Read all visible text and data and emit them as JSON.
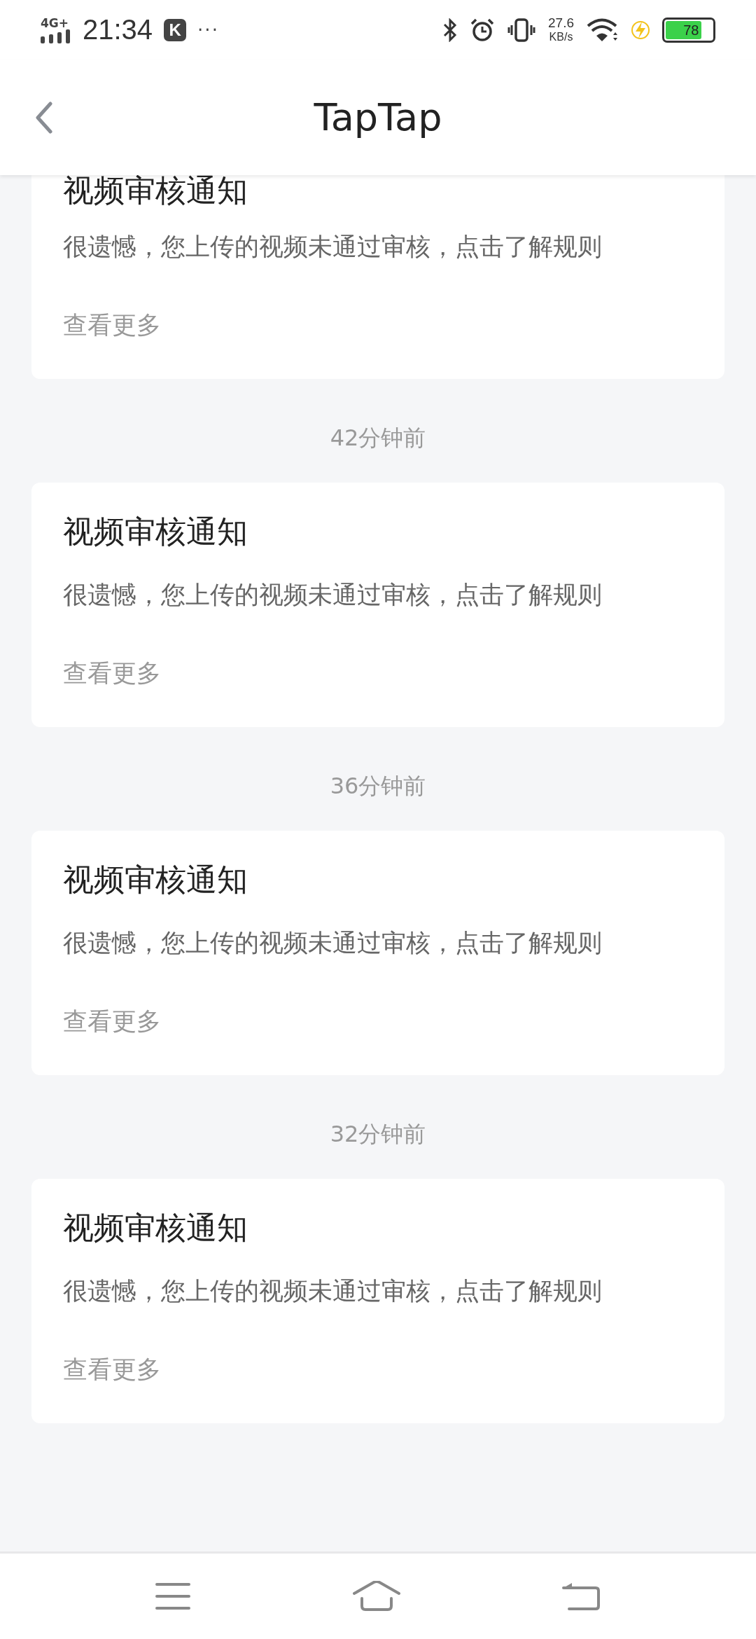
{
  "status_bar": {
    "network": "4G+",
    "time": "21:34",
    "app_badge": "K",
    "more": "···",
    "speed_value": "27.6",
    "speed_unit": "KB/s",
    "battery": "78"
  },
  "header": {
    "title": "TapTap"
  },
  "notifications": [
    {
      "kind": "cut",
      "title": "视频审核通知",
      "body": "很遗憾，您上传的视频未通过审核，点击了解规则",
      "more": "查看更多"
    },
    {
      "kind": "full",
      "time": "42分钟前",
      "title": "视频审核通知",
      "body": "很遗憾，您上传的视频未通过审核，点击了解规则",
      "more": "查看更多"
    },
    {
      "kind": "full",
      "time": "36分钟前",
      "title": "视频审核通知",
      "body": "很遗憾，您上传的视频未通过审核，点击了解规则",
      "more": "查看更多"
    },
    {
      "kind": "full",
      "time": "32分钟前",
      "title": "视频审核通知",
      "body": "很遗憾，您上传的视频未通过审核，点击了解规则",
      "more": "查看更多"
    }
  ]
}
